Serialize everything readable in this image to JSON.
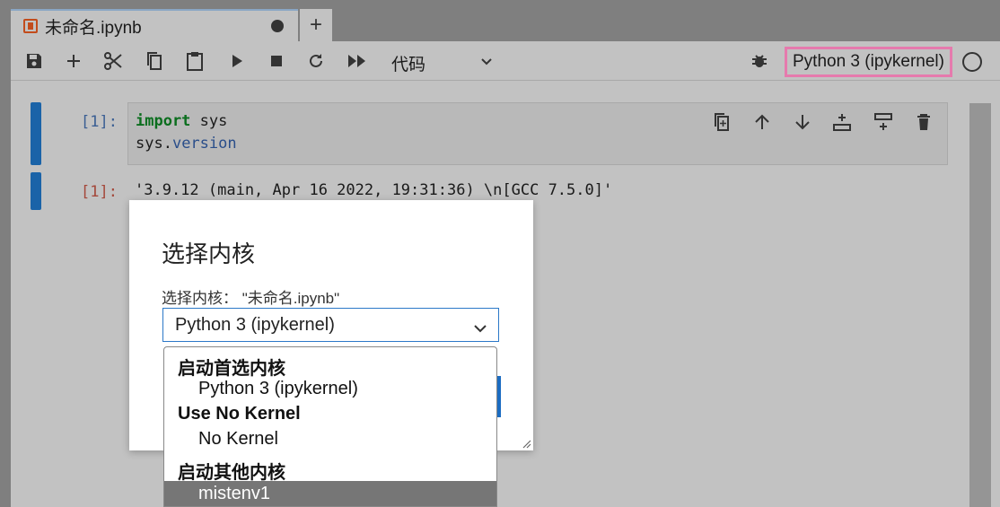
{
  "tab": {
    "title": "未命名.ipynb",
    "add_label": "+"
  },
  "toolbar": {
    "cell_type": "代码",
    "kernel_name": "Python 3 (ipykernel)",
    "icons": [
      "save-icon",
      "add-icon",
      "cut-icon",
      "copy-icon",
      "paste-icon",
      "run-icon",
      "stop-icon",
      "restart-icon",
      "run-all-icon",
      "chevron-down-icon",
      "debugger-icon",
      "kernel-idle-icon"
    ]
  },
  "cells": {
    "input_prompt": "[1]:",
    "code_line1_kw": "import",
    "code_line1_rest": " sys",
    "code_line2_obj": "sys.",
    "code_line2_attr": "version",
    "output_prompt": "[1]:",
    "output_text": "'3.9.12 (main, Apr 16 2022, 19:31:36) \\n[GCC 7.5.0]'",
    "cell_tool_icons": [
      "duplicate-icon",
      "move-up-icon",
      "move-down-icon",
      "insert-above-icon",
      "insert-below-icon",
      "delete-icon"
    ]
  },
  "dialog": {
    "title": "选择内核",
    "subtitle": "选择内核：  \"未命名.ipynb\"",
    "selected_kernel": "Python 3 (ipykernel)"
  },
  "dropdown": {
    "group1": "启动首选内核",
    "option1": "Python 3 (ipykernel)",
    "group2": "Use No Kernel",
    "option2": "No Kernel",
    "group3": "启动其他内核",
    "option3": "mistenv1"
  },
  "colors": {
    "cell_bar": "#1a63a8",
    "kernel_highlight": "#e67aad",
    "keyword": "#0b6e1e",
    "dialog_button": "#1b6cc2"
  }
}
